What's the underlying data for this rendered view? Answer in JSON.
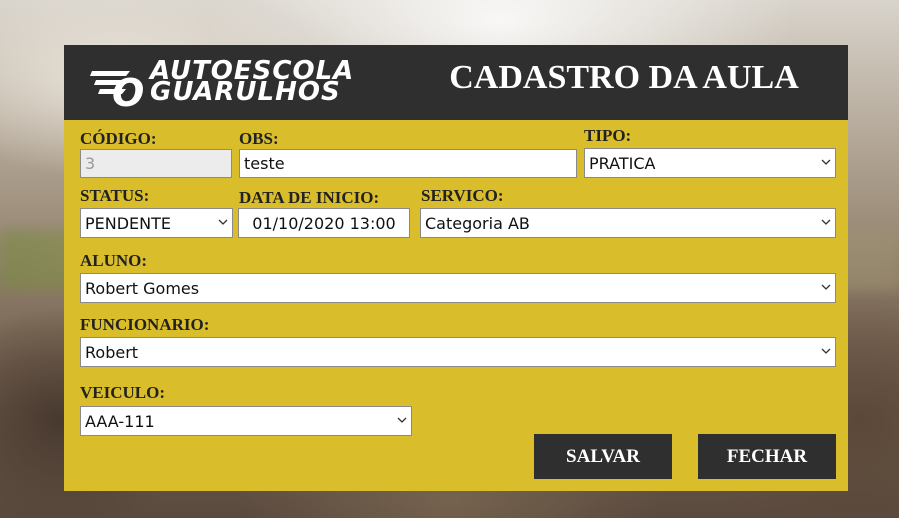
{
  "header": {
    "logo_line1": "AUTOESCOLA",
    "logo_line2": "GUARULHOS",
    "logo_o": "O",
    "title": "CADASTRO DA AULA"
  },
  "form": {
    "codigo": {
      "label": "CÓDIGO:",
      "value": "3"
    },
    "obs": {
      "label": "OBS:",
      "value": "teste"
    },
    "tipo": {
      "label": "TIPO:",
      "value": "PRATICA"
    },
    "status": {
      "label": "STATUS:",
      "value": "PENDENTE"
    },
    "data_inicio": {
      "label": "DATA DE INICIO:",
      "value": "01/10/2020 13:00"
    },
    "servico": {
      "label": "SERVICO:",
      "value": "Categoria AB"
    },
    "aluno": {
      "label": "ALUNO:",
      "value": "Robert Gomes"
    },
    "funcionario": {
      "label": "FUNCIONARIO:",
      "value": "Robert"
    },
    "veiculo": {
      "label": "VEICULO:",
      "value": "AAA-111"
    }
  },
  "buttons": {
    "salvar": "SALVAR",
    "fechar": "FECHAR"
  },
  "colors": {
    "panel_bg": "#d9bd2b",
    "header_bg": "#2f2f2f",
    "button_bg": "#2f2f2f"
  },
  "icons": {
    "select_arrow": "chevron-down-icon"
  }
}
